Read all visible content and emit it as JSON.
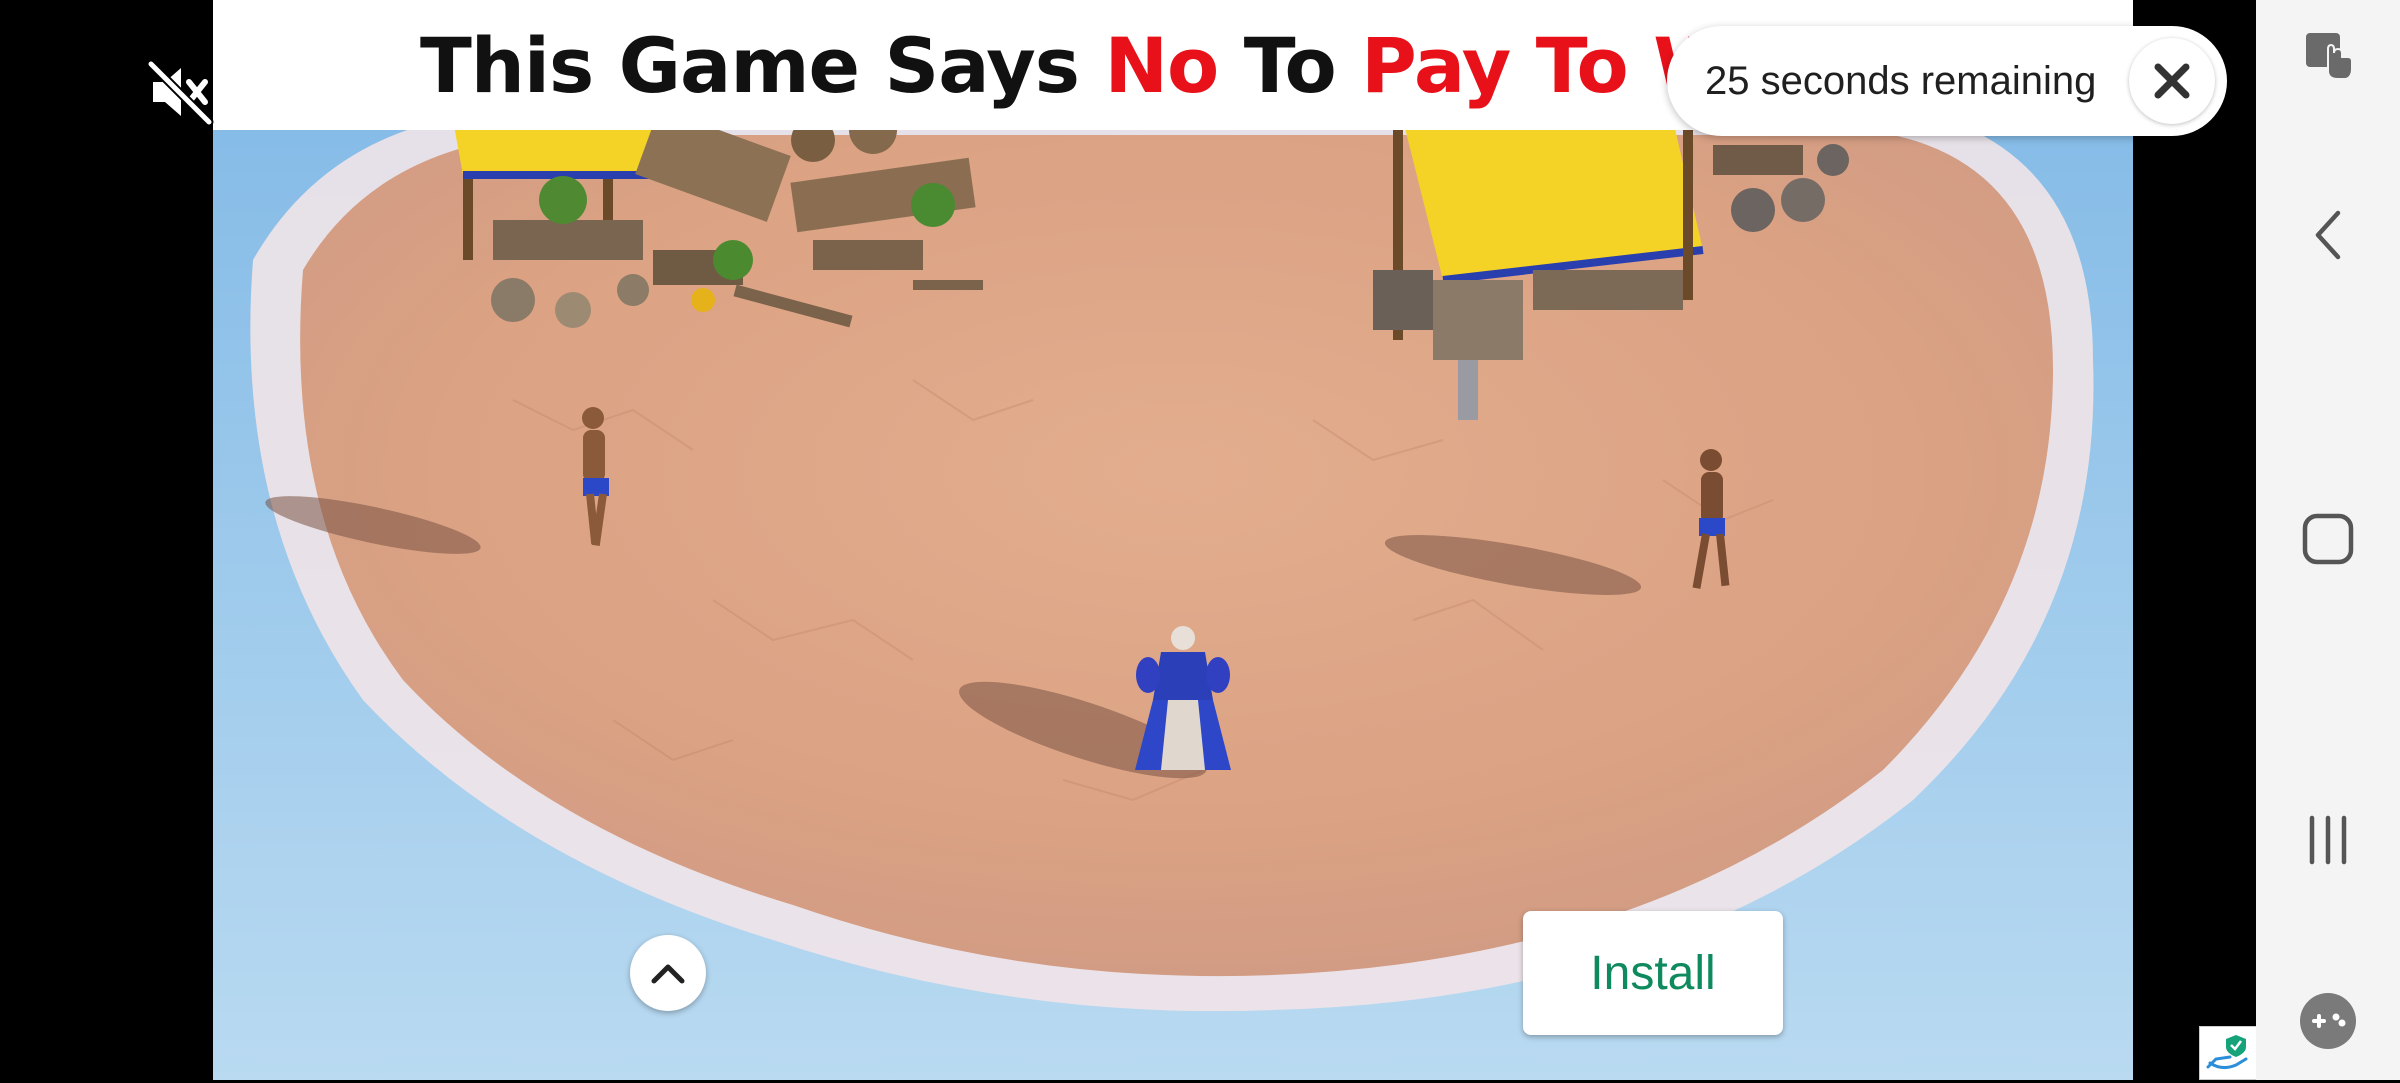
{
  "banner": {
    "part1": "This Game Says ",
    "part2": "No",
    "part3": " To ",
    "part4": "Pay To W"
  },
  "ad_overlay": {
    "countdown_text": "25 seconds remaining",
    "install_label": "Install"
  },
  "icons": {
    "mute": "speaker-muted-icon",
    "close": "close-icon",
    "expand": "chevron-up-icon",
    "ad_badge": "ad-choices-icon"
  },
  "system_nav": {
    "items": [
      "screen-touch-icon",
      "back-icon",
      "home-icon",
      "recents-icon",
      "game-launcher-icon"
    ]
  },
  "colors": {
    "banner_red": "#e8111a",
    "install_green": "#0f8a5f",
    "sand": "#e0a98a",
    "water": "#9fcdee"
  }
}
